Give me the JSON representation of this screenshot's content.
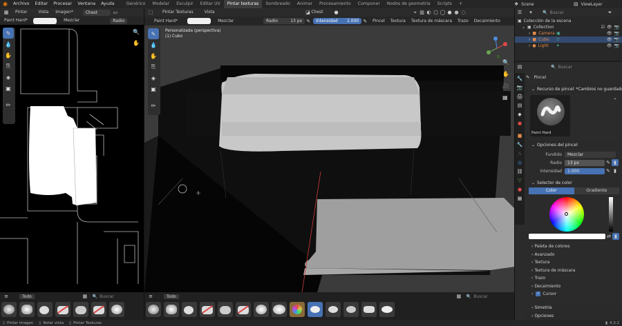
{
  "menubar": {
    "items": [
      "Archivo",
      "Editar",
      "Procesar",
      "Ventana",
      "Ayuda"
    ],
    "workspaces": [
      "Genérico",
      "Modelar",
      "Esculpir",
      "Editar UV",
      "Pintar texturas",
      "Sombreado",
      "Animar",
      "Procesamiento",
      "Componer",
      "Nodos de geometría",
      "Scripts"
    ],
    "active_workspace": "Pintar texturas",
    "add_tab": "+",
    "scene": "Scene",
    "view_layer": "ViewLayer"
  },
  "image_editor": {
    "mode": "Pintar",
    "menus": [
      "Vista",
      "Imagen*"
    ],
    "image_name": "Chest",
    "brush": "Paint Hard*",
    "blend": "Mezclar",
    "radius_label": "Radio",
    "brushes_label": "Todo",
    "search_placeholder": "Buscar"
  },
  "viewport": {
    "mode": "Pintar Texturas",
    "menus": [
      "Vista"
    ],
    "brush": "Paint Hard*",
    "blend": "Mezclar",
    "radius_label": "Radio",
    "radius_value": "13 px",
    "strength_label": "Intensidad",
    "strength_value": "1.000",
    "header_menus": [
      "Pincel",
      "Textura",
      "Textura de máscara",
      "Trazo",
      "Decaimiento"
    ],
    "texture_slot": "Chest",
    "overlay_title": "Personalizada (perspectiva)",
    "overlay_object": "(1) Cubo",
    "brushes_label": "Todo",
    "search_placeholder": "Buscar"
  },
  "outliner": {
    "search_placeholder": "Buscar",
    "root": "Colección de la escena",
    "collection": "Collection",
    "items": [
      {
        "name": "Camera",
        "color": "#e08a4b"
      },
      {
        "name": "Cubo",
        "color": "#e08a4b"
      },
      {
        "name": "Light",
        "color": "#e08a4b"
      }
    ]
  },
  "properties": {
    "search_placeholder": "Buscar",
    "tab_title": "Pincel",
    "brush_resource_label": "Recurso de pincel",
    "unsaved": "*Cambios no guardados",
    "brush_preview_name": "Paint Hard",
    "brush_settings_label": "Opciones del pincel",
    "blend_label": "Fundido",
    "blend_value": "Mezclar",
    "radius_label": "Radio",
    "radius_value": "13 px",
    "strength_label": "Intensidad",
    "strength_value": "1.000",
    "color_picker_label": "Selector de color",
    "color_tab": "Color",
    "gradient_tab": "Gradiente",
    "subpanels": [
      "Paleta de colores",
      "Avanzado",
      "Textura",
      "Textura de máscara",
      "Trazo",
      "Decaimiento"
    ],
    "cursor_label": "Cursor",
    "symmetry_label": "Simetría",
    "options_label": "Opciones"
  },
  "statusbar": {
    "items": [
      "Pintar imagen",
      "Rotar vista",
      "Pintar Texturas"
    ],
    "version": "4.3.2"
  },
  "colors": {
    "accent": "#4772b3",
    "object_orange": "#e08a4b"
  }
}
